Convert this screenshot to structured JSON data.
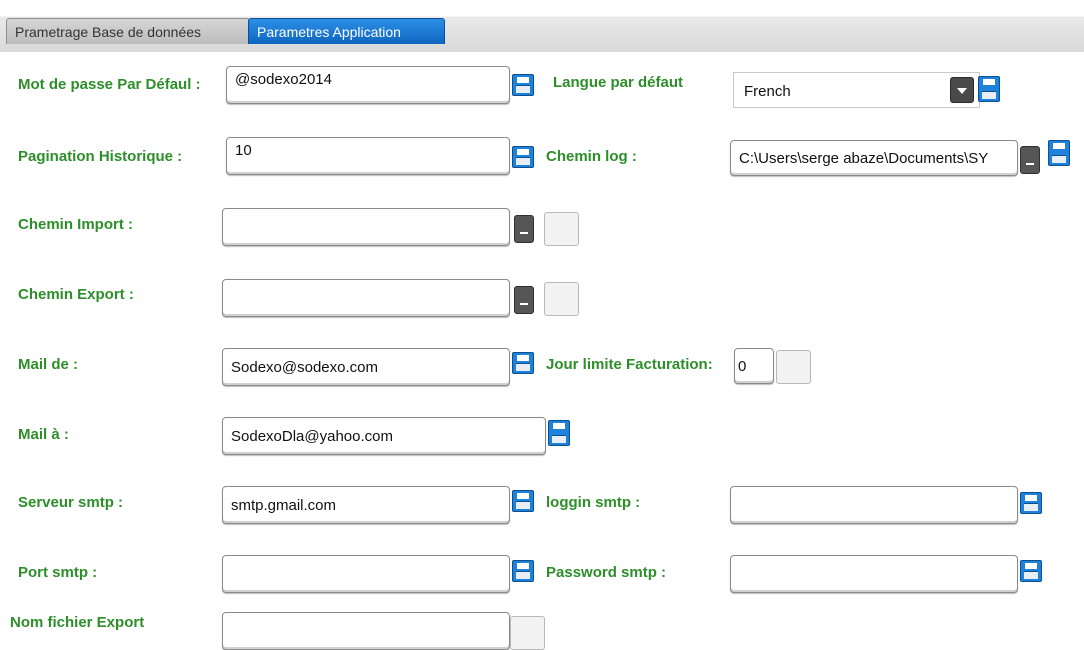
{
  "tabs": [
    {
      "label": "Prametrage Base de données"
    },
    {
      "label": "Parametres Application"
    }
  ],
  "form": {
    "default_password": {
      "label": "Mot de passe Par Défaul :",
      "value": "@sodexo2014"
    },
    "default_language": {
      "label": "Langue par défaut",
      "value": "French"
    },
    "history_pagination": {
      "label": "Pagination Historique :",
      "value": "10"
    },
    "log_path": {
      "label": "Chemin log :",
      "value": "C:\\Users\\serge abaze\\Documents\\SY"
    },
    "import_path": {
      "label": "Chemin Import :",
      "value": ""
    },
    "export_path": {
      "label": "Chemin Export :",
      "value": ""
    },
    "mail_from": {
      "label": "Mail de :",
      "value": "Sodexo@sodexo.com"
    },
    "billing_limit_day": {
      "label": "Jour limite Facturation:",
      "value": "0"
    },
    "mail_to": {
      "label": "Mail à :",
      "value": "SodexoDla@yahoo.com"
    },
    "smtp_server": {
      "label": "Serveur smtp :",
      "value": "smtp.gmail.com"
    },
    "smtp_login": {
      "label": "loggin smtp :",
      "value": ""
    },
    "smtp_port": {
      "label": "Port smtp :",
      "value": ""
    },
    "smtp_password": {
      "label": "Password smtp :",
      "value": ""
    },
    "export_filename": {
      "label": "Nom fichier Export",
      "value": ""
    }
  },
  "icons": {
    "save": "save-icon",
    "browse": "browse-button",
    "dropdown": "chevron-down-icon"
  },
  "colors": {
    "label_green": "#2d8f2a",
    "tab_active": "#1a78d4",
    "save_icon": "#1e82dc"
  }
}
